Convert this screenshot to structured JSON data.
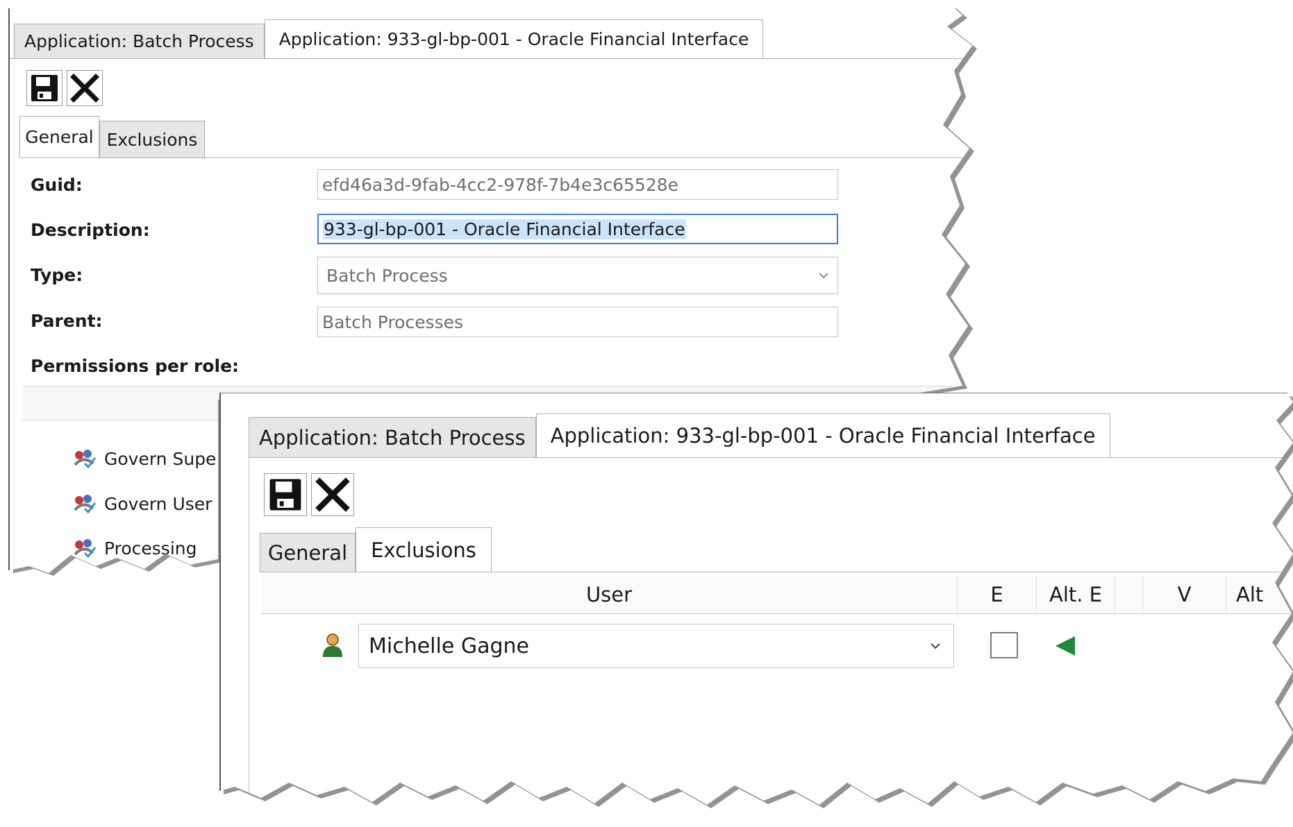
{
  "back_panel": {
    "tabs": [
      {
        "label": "Application: Batch Process",
        "active": false
      },
      {
        "label": "Application: 933-gl-bp-001 - Oracle Financial Interface",
        "active": true
      }
    ],
    "toolbar": {
      "save_icon": "floppy-disk-icon",
      "close_icon": "close-x-icon"
    },
    "sub_tabs": [
      {
        "label": "General",
        "active": true
      },
      {
        "label": "Exclusions",
        "active": false
      }
    ],
    "form": {
      "guid_label": "Guid:",
      "guid_value": "efd46a3d-9fab-4cc2-978f-7b4e3c65528e",
      "description_label": "Description:",
      "description_value": "933-gl-bp-001 - Oracle Financial Interface",
      "type_label": "Type:",
      "type_value": "Batch Process",
      "parent_label": "Parent:",
      "parent_value": "Batch Processes",
      "permissions_label": "Permissions per role:"
    },
    "roles": [
      {
        "label": "Govern Supe",
        "icon": "role-group-icon"
      },
      {
        "label": "Govern User",
        "icon": "role-group-icon"
      },
      {
        "label": "Processing",
        "icon": "role-group-icon"
      }
    ]
  },
  "front_panel": {
    "tabs": [
      {
        "label": "Application: Batch Process",
        "active": false
      },
      {
        "label": "Application: 933-gl-bp-001 - Oracle Financial Interface",
        "active": true
      }
    ],
    "toolbar": {
      "save_icon": "floppy-disk-icon",
      "close_icon": "close-x-icon"
    },
    "sub_tabs": [
      {
        "label": "General",
        "active": false
      },
      {
        "label": "Exclusions",
        "active": true
      }
    ],
    "grid": {
      "columns": [
        "User",
        "E",
        "Alt. E",
        "",
        "V",
        "Alt"
      ],
      "rows": [
        {
          "user": "Michelle Gagne",
          "user_icon": "user-person-icon",
          "e_checked": false,
          "alt_e_icon": "green-left-arrow-icon"
        }
      ]
    }
  },
  "colors": {
    "selection": "#cce4fa",
    "focus_border": "#3b7ddd",
    "arrow_green": "#1e8a3a",
    "tab_inactive": "#e6e6e6"
  }
}
